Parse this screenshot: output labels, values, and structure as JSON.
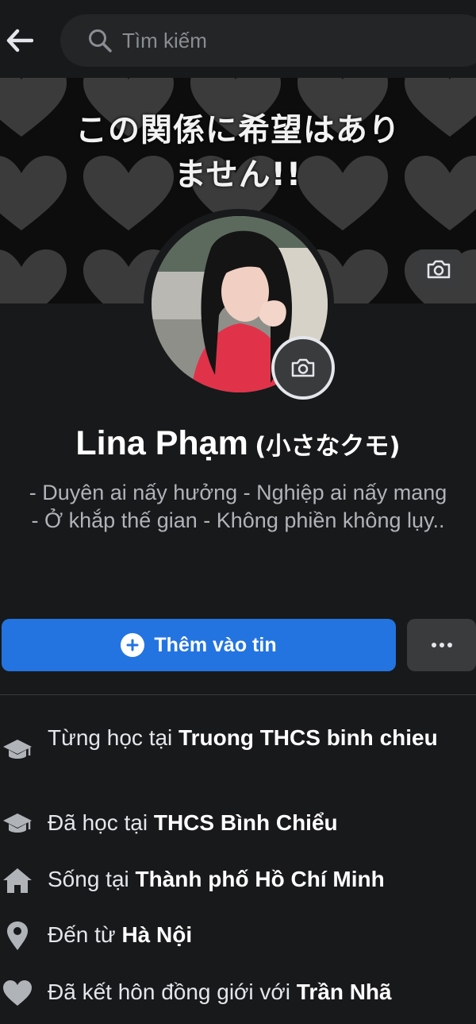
{
  "search": {
    "placeholder": "Tìm kiếm"
  },
  "cover": {
    "text_line1": "この関係に希望はあり",
    "text_line2": "ません!!"
  },
  "profile": {
    "name": "Lina Phạm",
    "nickname": "(小さなクモ)",
    "bio_line1": "- Duyên ai nấy hưởng - Nghiệp ai nấy mang",
    "bio_line2": "- Ở khắp thế gian - Không phiền không lụy.."
  },
  "actions": {
    "add_story_label": "Thêm vào tin",
    "more_label": "•••"
  },
  "details": [
    {
      "icon": "graduation-cap-icon",
      "prefix": "Từng học tại ",
      "value": "Truong THCS binh chieu"
    },
    {
      "icon": "graduation-cap-icon",
      "prefix": "Đã học tại ",
      "value": "THCS Bình Chiểu"
    },
    {
      "icon": "home-icon",
      "prefix": "Sống tại ",
      "value": "Thành phố Hồ Chí Minh"
    },
    {
      "icon": "location-pin-icon",
      "prefix": "Đến từ ",
      "value": "Hà Nội"
    },
    {
      "icon": "heart-icon",
      "prefix": "Đã kết hôn đồng giới với ",
      "value": "Trần Nhã"
    }
  ],
  "colors": {
    "background": "#18191a",
    "accent": "#2374e1",
    "secondary_text": "#b0b3b8"
  }
}
